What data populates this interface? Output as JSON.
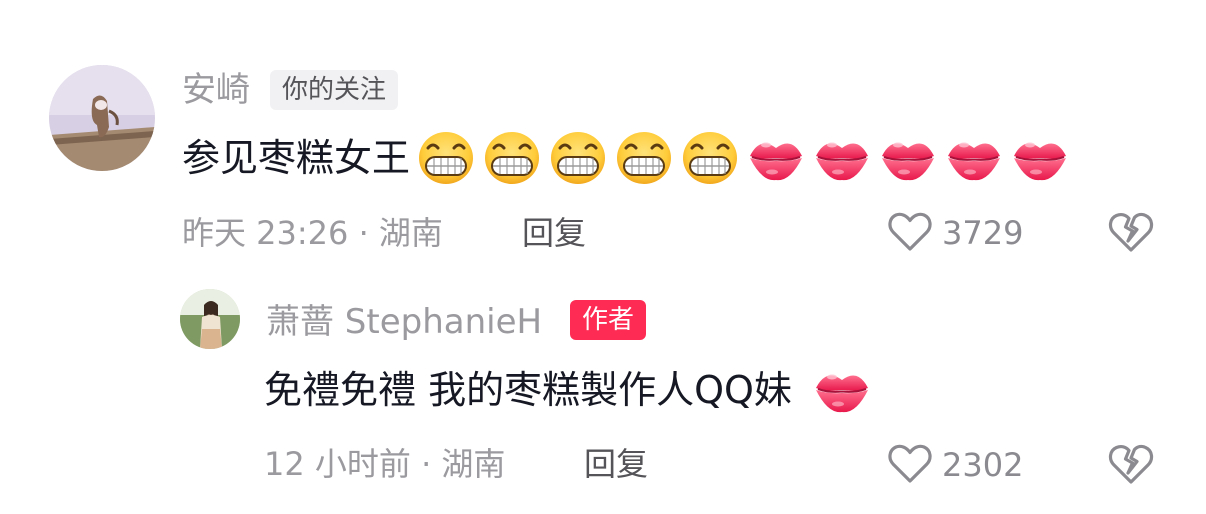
{
  "comments": [
    {
      "username": "安崎",
      "tag": "你的关注",
      "text": "参见枣糕女王",
      "emojis": [
        "grin-emoji",
        "grin-emoji",
        "grin-emoji",
        "grin-emoji",
        "grin-emoji",
        "kiss-lips-emoji",
        "kiss-lips-emoji",
        "kiss-lips-emoji",
        "kiss-lips-emoji",
        "kiss-lips-emoji"
      ],
      "meta": "昨天 23:26 · 湖南",
      "reply_label": "回复",
      "likes": "3729",
      "avatar_icon": "cartoon-avatar"
    },
    {
      "username": "萧蔷 StephanieH",
      "tag": "作者",
      "text": "免禮免禮 我的枣糕製作人QQ妹",
      "emojis": [
        "kiss-lips-emoji"
      ],
      "meta": "12 小时前 · 湖南",
      "reply_label": "回复",
      "likes": "2302",
      "avatar_icon": "photo-avatar"
    }
  ],
  "colors": {
    "author_tag": "#fe2c55",
    "follow_tag_bg": "#f1f1f3",
    "muted_text": "#9a9a9f",
    "body_text": "#161823"
  },
  "icons": {
    "like": "heart-outline-icon",
    "dislike": "broken-heart-icon"
  }
}
